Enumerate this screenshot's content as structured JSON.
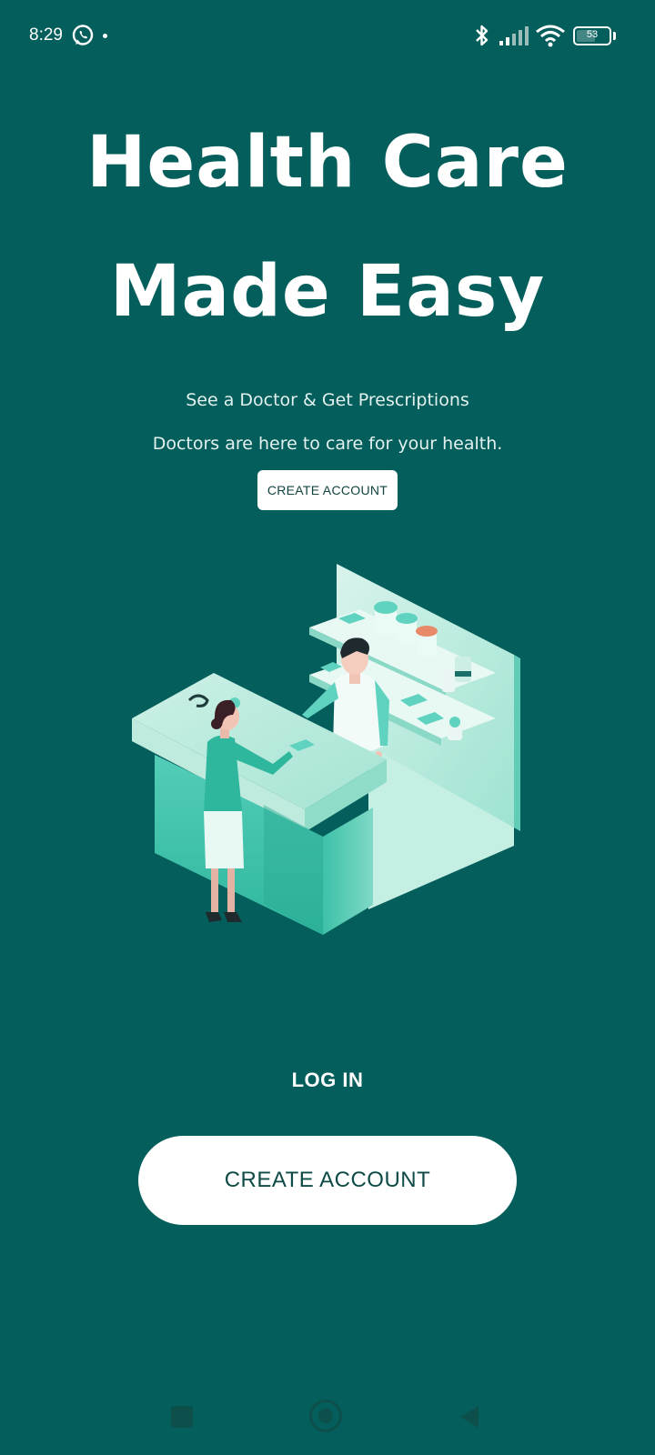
{
  "status_bar": {
    "time": "8:29",
    "battery": "53",
    "icons": [
      "whatsapp-icon",
      "notification-dot",
      "bluetooth-icon",
      "signal-icon",
      "wifi-icon",
      "battery-icon"
    ]
  },
  "hero": {
    "title_line1": "Health Care",
    "title_line2": "Made Easy",
    "subtitle_line1": "See a Doctor & Get Prescriptions",
    "subtitle_line2": "Doctors are here to care for your health."
  },
  "top_cta": {
    "label": "CREATE ACCOUNT"
  },
  "login": {
    "label": "LOG IN"
  },
  "bottom_cta": {
    "label": "CREATE ACCOUNT"
  },
  "nav_bar": {
    "icons": [
      "recents-icon",
      "home-icon",
      "back-icon"
    ]
  },
  "colors": {
    "background": "#045e5b",
    "button_bg": "#ffffff",
    "button_text": "#0e4a46",
    "illustration_accent": "#5fd3c0"
  }
}
